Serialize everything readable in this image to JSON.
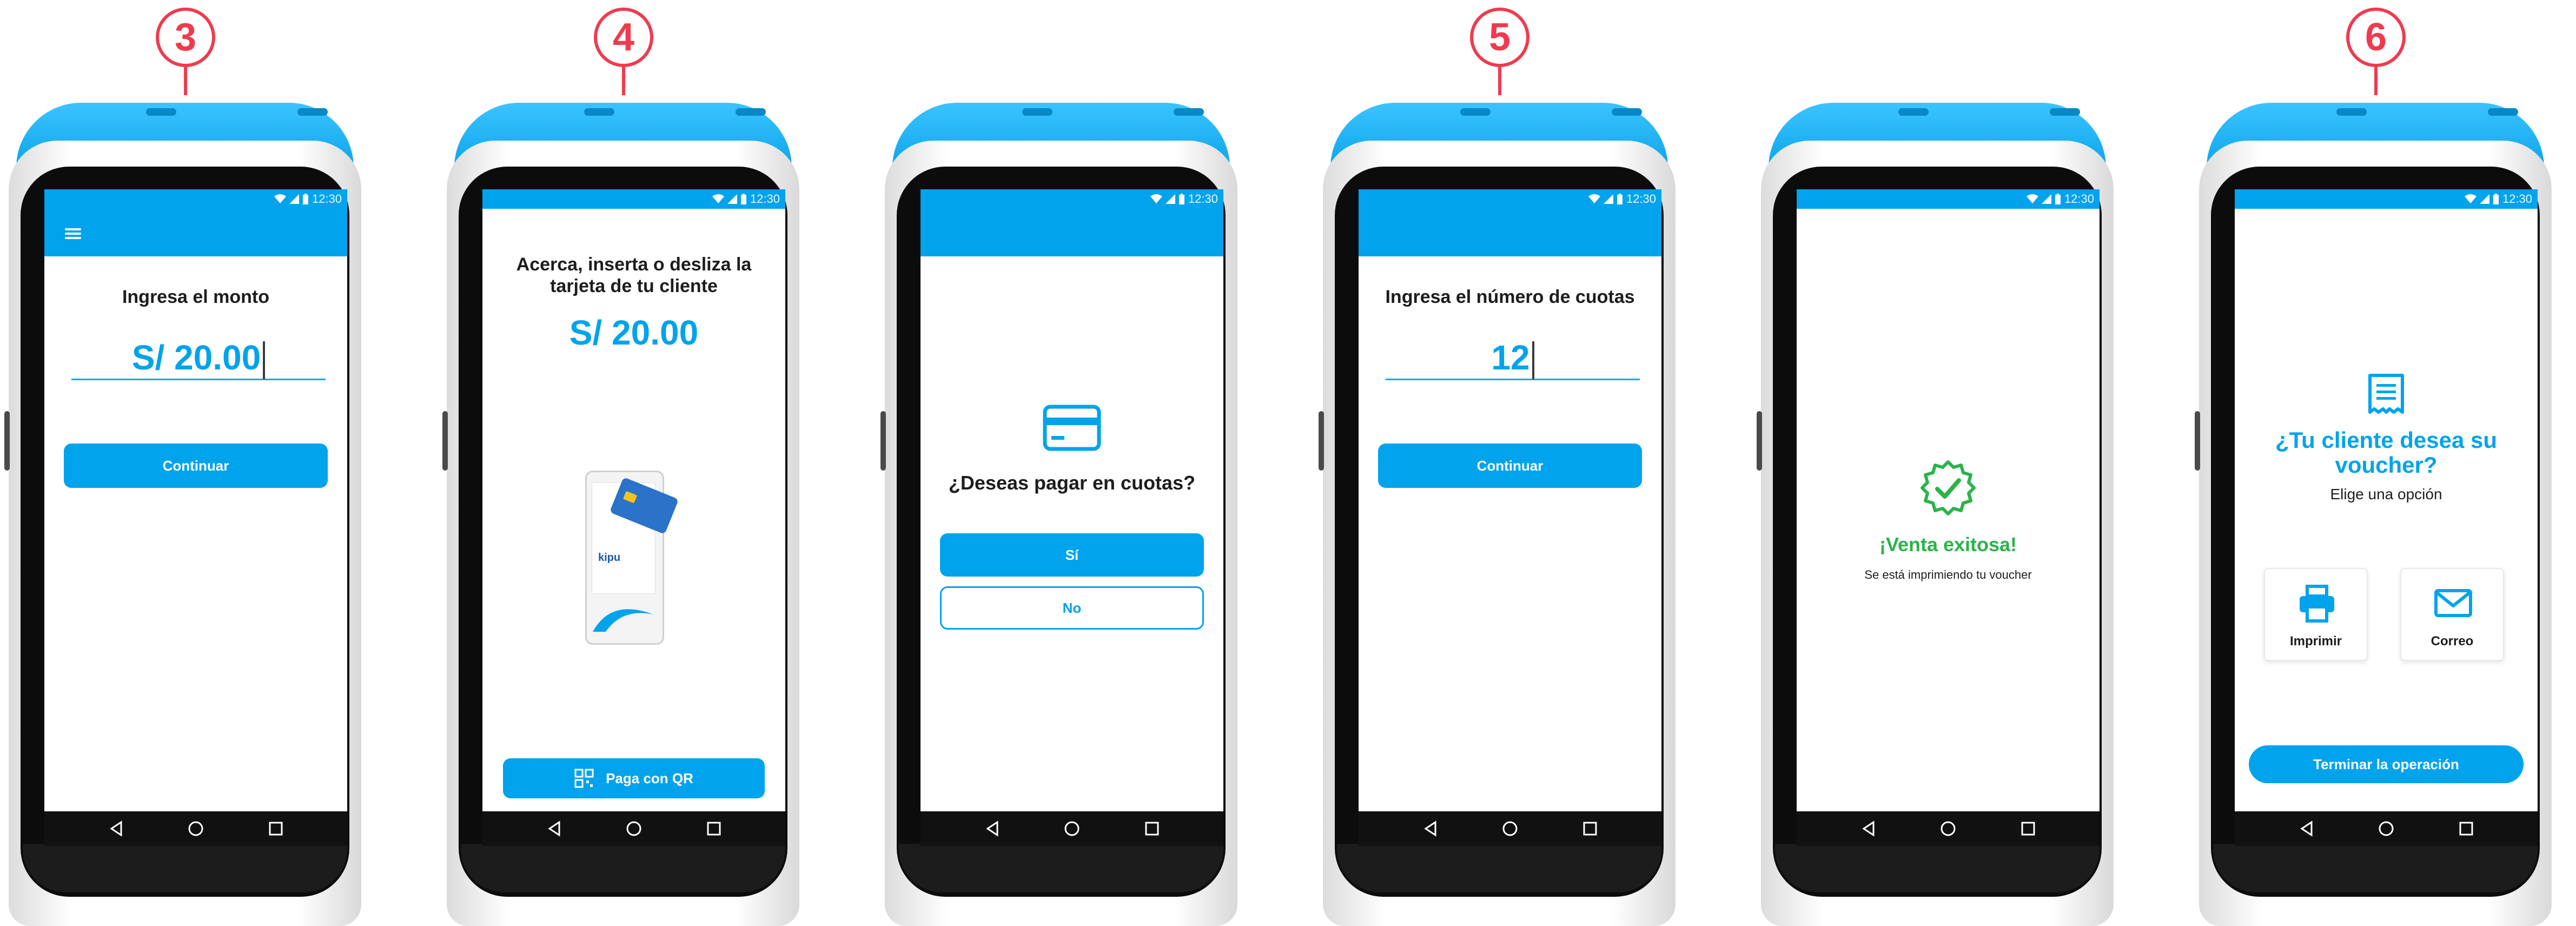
{
  "brand": {
    "accent": "#00a3ec",
    "step_color": "#ef3b4f",
    "success": "#2bb34a"
  },
  "status_bar": {
    "time": "12:30"
  },
  "steps": [
    "3",
    "4",
    "",
    "5",
    "",
    "6"
  ],
  "screens": {
    "amount": {
      "title": "Ingresa el monto",
      "value": "S/ 20.00",
      "continue_label": "Continuar"
    },
    "card": {
      "title_line1": "Acerca, inserta o desliza la",
      "title_line2": "tarjeta de tu cliente",
      "amount": "S/ 20.00",
      "device_brand": "kipu",
      "qr_label": "Paga con QR"
    },
    "installments_question": {
      "question": "¿Deseas pagar en cuotas?",
      "yes_label": "Sí",
      "no_label": "No"
    },
    "installments_number": {
      "title": "Ingresa el número de cuotas",
      "value": "12",
      "continue_label": "Continuar"
    },
    "success": {
      "title": "¡Venta exitosa!",
      "subtitle": "Se está imprimiendo tu voucher"
    },
    "voucher": {
      "title_line1": "¿Tu cliente desea su",
      "title_line2": "voucher?",
      "subtitle": "Elige una opción",
      "print_label": "Imprimir",
      "email_label": "Correo",
      "finish_label": "Terminar la operación"
    }
  }
}
